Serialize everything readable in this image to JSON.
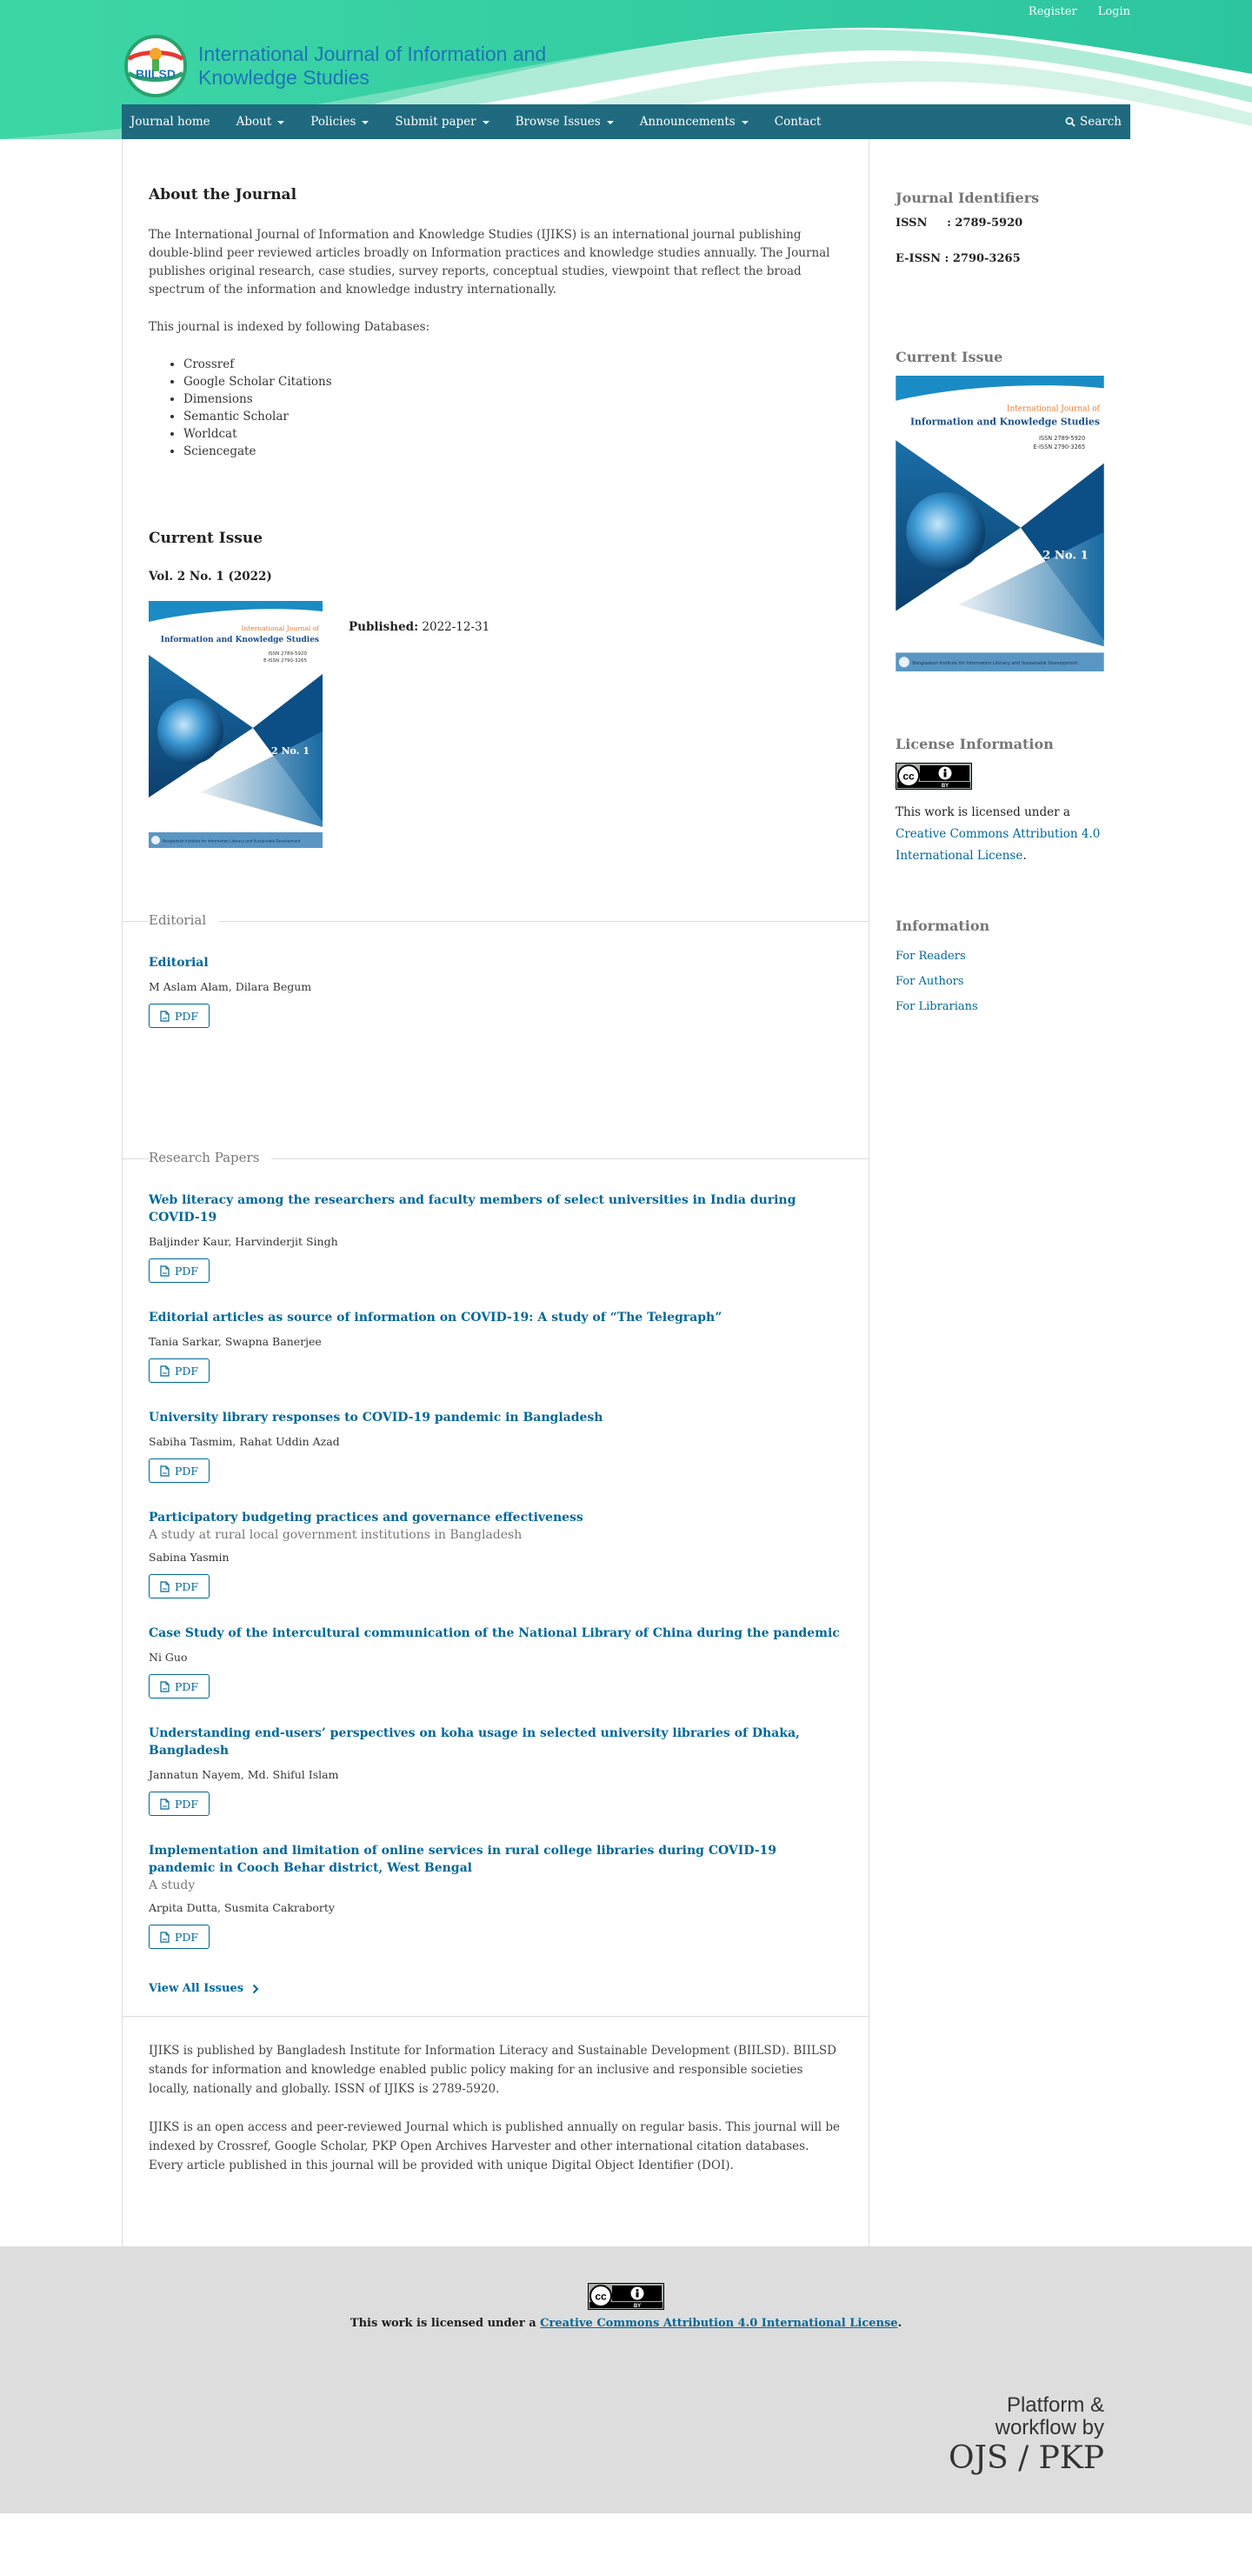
{
  "header": {
    "user_links": {
      "register": "Register",
      "login": "Login"
    },
    "journal_title": "International Journal of Information and Knowledge Studies",
    "logo_text": "BIILSD"
  },
  "nav": {
    "items": [
      {
        "label": "Journal home",
        "dropdown": false
      },
      {
        "label": "About",
        "dropdown": true
      },
      {
        "label": "Policies",
        "dropdown": true
      },
      {
        "label": "Submit paper",
        "dropdown": true
      },
      {
        "label": "Browse Issues",
        "dropdown": true
      },
      {
        "label": "Announcements",
        "dropdown": true
      },
      {
        "label": "Contact",
        "dropdown": false
      }
    ],
    "search_label": "Search"
  },
  "about": {
    "title": "About the Journal",
    "description": "The International Journal of Information and Knowledge Studies (IJIKS) is an international journal publishing double-blind peer reviewed articles broadly on Information practices and knowledge studies annually. The Journal publishes original research, case studies, survey reports, conceptual studies, viewpoint that reflect the broad spectrum of the information and knowledge industry internationally.",
    "indexed_intro": "This journal is indexed by following Databases:",
    "databases": [
      "Crossref",
      "Google Scholar Citations",
      "Dimensions",
      "Semantic Scholar",
      "Worldcat",
      "Sciencegate"
    ]
  },
  "current_issue": {
    "title": "Current Issue",
    "identification": "Vol. 2 No. 1 (2022)",
    "published_label": "Published:",
    "published_date": "2022-12-31",
    "cover": {
      "journal_line1": "International Journal of",
      "journal_line2": "Information and Knowledge Studies",
      "issn": "ISSN 2789-5920",
      "eissn": "E-ISSN 2790-3265",
      "volume": "Vol. 2 No. 1",
      "footer": "Bangladesh Institute for Information Literacy and Sustainable Development"
    }
  },
  "sections": [
    {
      "title": "Editorial",
      "articles": [
        {
          "title": "Editorial",
          "subtitle": "",
          "authors": "M Aslam Alam, Dilara Begum",
          "galley": "PDF"
        }
      ]
    },
    {
      "title": "Research Papers",
      "articles": [
        {
          "title": "Web literacy among the researchers and faculty members of select universities in India during COVID-19",
          "subtitle": "",
          "authors": "Baljinder Kaur, Harvinderjit Singh",
          "galley": "PDF"
        },
        {
          "title": "Editorial articles as source of information on COVID-19: A study of “The Telegraph”",
          "subtitle": "",
          "authors": "Tania Sarkar, Swapna Banerjee",
          "galley": "PDF"
        },
        {
          "title": "University library responses to COVID-19 pandemic in Bangladesh",
          "subtitle": "",
          "authors": "Sabiha Tasmim, Rahat Uddin Azad",
          "galley": "PDF"
        },
        {
          "title": "Participatory budgeting practices and governance effectiveness",
          "subtitle": "A study at rural local government institutions in Bangladesh",
          "authors": "Sabina Yasmin",
          "galley": "PDF"
        },
        {
          "title": "Case Study of the intercultural communication of the National Library of China during the pandemic",
          "subtitle": "",
          "authors": "Ni Guo",
          "galley": "PDF"
        },
        {
          "title": "Understanding end-users’ perspectives on koha usage in selected university libraries of Dhaka, Bangladesh",
          "subtitle": "",
          "authors": "Jannatun Nayem, Md. Shiful Islam",
          "galley": "PDF"
        },
        {
          "title": "Implementation and limitation of online services in rural college libraries during COVID-19 pandemic in Cooch Behar district, West Bengal",
          "subtitle": "A study",
          "authors": "Arpita Dutta, Susmita Cakraborty",
          "galley": "PDF"
        }
      ]
    }
  ],
  "view_all": "View All Issues",
  "additional": [
    "IJIKS is published by Bangladesh Institute for Information Literacy and Sustainable Development (BIILSD). BIILSD stands for information and knowledge enabled public policy making for an inclusive and responsible societies locally, nationally and globally. ISSN of IJIKS is 2789-5920.",
    "IJIKS is an open access and peer-reviewed Journal which is published annually on regular basis. This journal will be indexed by Crossref, Google Scholar, PKP Open Archives Harvester and other international citation databases. Every article published in this journal will be provided with unique Digital Object Identifier (DOI)."
  ],
  "sidebar": {
    "identifiers_title": "Journal Identifiers",
    "issn": "ISSN     : 2789-5920",
    "eissn": "E-ISSN : 2790-3265",
    "current_issue_title": "Current Issue",
    "license_title": "License Information",
    "license_prefix": "This work is licensed under a ",
    "license_link": "Creative Commons Attribution 4.0 International License",
    "license_suffix": ".",
    "information_title": "Information",
    "information_links": [
      "For Readers",
      "For Authors",
      "For Librarians"
    ]
  },
  "footer": {
    "license_prefix": "This work is licensed under a ",
    "license_link": "Creative Commons Attribution 4.0 International License",
    "license_suffix": ".",
    "platform_line1": "Platform &",
    "platform_line2": "workflow by",
    "platform_brand": "OJS / PKP"
  },
  "colors": {
    "header_teal": "#2fcf9c",
    "nav_bg": "#1f6a7f",
    "link": "#006798",
    "footer_bg": "#dddddd"
  }
}
